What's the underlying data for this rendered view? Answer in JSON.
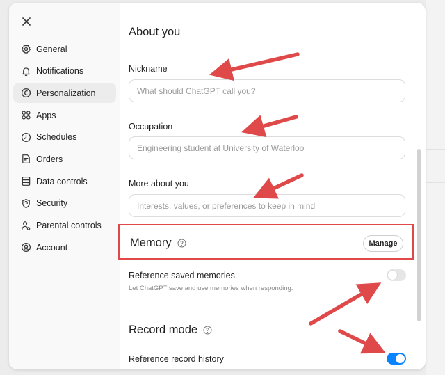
{
  "close_icon": "close-icon",
  "sidebar": {
    "items": [
      {
        "label": "General",
        "icon": "gear-icon"
      },
      {
        "label": "Notifications",
        "icon": "bell-icon"
      },
      {
        "label": "Personalization",
        "icon": "personalization-icon"
      },
      {
        "label": "Apps",
        "icon": "apps-grid-icon"
      },
      {
        "label": "Schedules",
        "icon": "clock-icon"
      },
      {
        "label": "Orders",
        "icon": "receipt-icon"
      },
      {
        "label": "Data controls",
        "icon": "database-icon"
      },
      {
        "label": "Security",
        "icon": "shield-icon"
      },
      {
        "label": "Parental controls",
        "icon": "family-icon"
      },
      {
        "label": "Account",
        "icon": "user-circle-icon"
      }
    ],
    "active": "Personalization"
  },
  "about": {
    "title": "About you",
    "nickname_label": "Nickname",
    "nickname_placeholder": "What should ChatGPT call you?",
    "occupation_label": "Occupation",
    "occupation_value": "Engineering student at University of Waterloo",
    "more_label": "More about you",
    "more_placeholder": "Interests, values, or preferences to keep in mind"
  },
  "memory": {
    "title": "Memory",
    "manage_label": "Manage",
    "reference_label": "Reference saved memories",
    "reference_desc": "Let ChatGPT save and use memories when responding.",
    "reference_enabled": false
  },
  "record": {
    "title": "Record mode",
    "history_label": "Reference record history",
    "history_enabled": true
  },
  "colors": {
    "annotation_red": "#e0494a",
    "toggle_on": "#0a84ff"
  }
}
